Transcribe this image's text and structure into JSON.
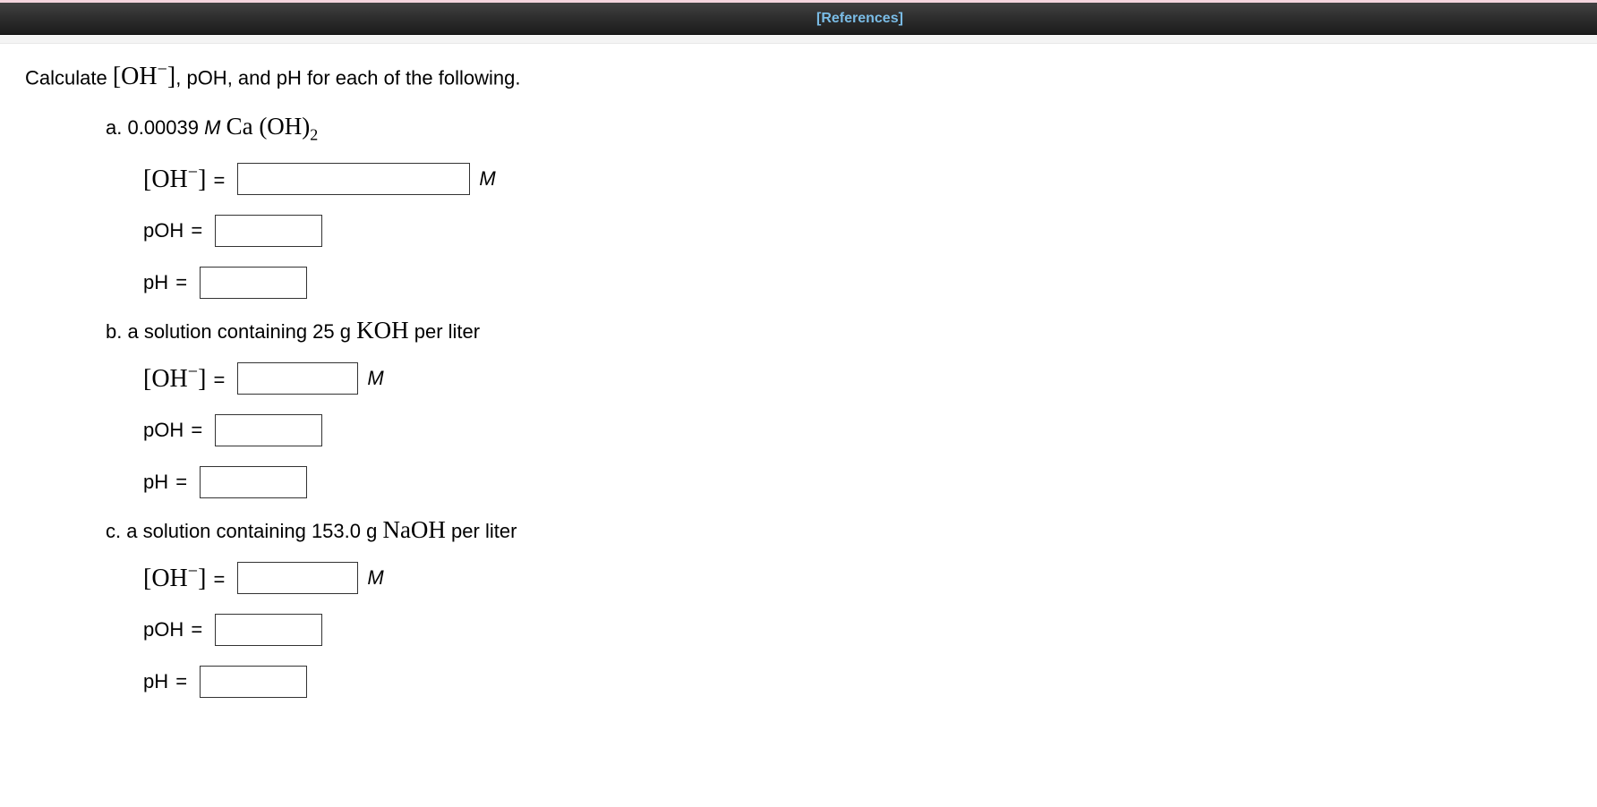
{
  "toolbar": {
    "references_label": "[References]"
  },
  "prompt": {
    "intro": "Calculate ",
    "after_oh": ", pOH, and pH for each of the following."
  },
  "labels": {
    "oh_prefix": "[",
    "oh_text": "OH",
    "oh_suffix": "]",
    "eq": " = ",
    "poh": "pOH",
    "ph": "pH",
    "unit_M": "M"
  },
  "parts": {
    "a": {
      "letter": "a.",
      "pre": " 0.00039 ",
      "conc_unit": "M",
      "space": " ",
      "chem_pre": "Ca",
      "chem_oh": " (OH)",
      "chem_sub": "2",
      "post": "",
      "inputs": {
        "oh_class": "input-wide",
        "poh_class": "input-sm",
        "ph_class": "input-sm"
      }
    },
    "b": {
      "letter": "b.",
      "pre": " a solution containing 25 g ",
      "chem": "KOH",
      "post": " per liter",
      "inputs": {
        "oh_class": "input-med",
        "poh_class": "input-sm",
        "ph_class": "input-sm"
      }
    },
    "c": {
      "letter": "c.",
      "pre": " a solution containing 153.0 g ",
      "chem": "NaOH",
      "post": " per liter",
      "inputs": {
        "oh_class": "input-med",
        "poh_class": "input-sm",
        "ph_class": "input-sm"
      }
    }
  }
}
